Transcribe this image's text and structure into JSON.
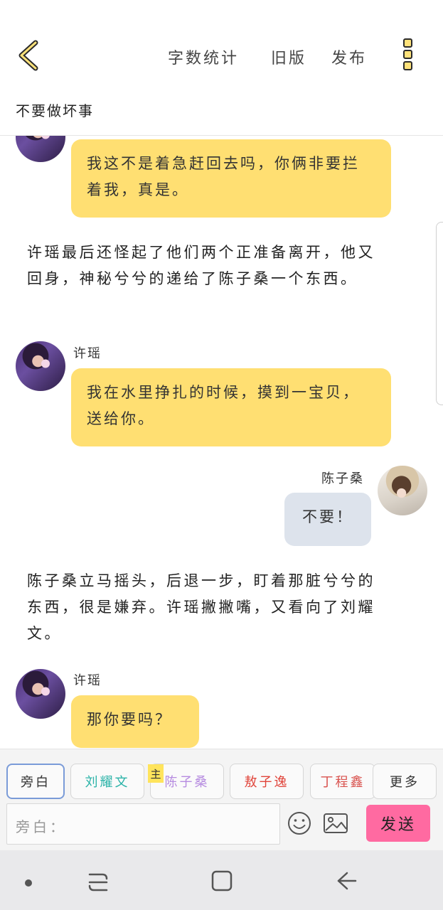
{
  "header": {
    "actions": {
      "word_count": "字数统计",
      "old_version": "旧版",
      "publish": "发布"
    }
  },
  "story": {
    "title": "不要做坏事"
  },
  "messages": {
    "m1": {
      "text": "我这不是着急赶回去吗，你俩非要拦着我，真是。"
    },
    "n1": {
      "text": "许瑶最后还怪起了他们两个正准备离开，他又回身，神秘兮兮的递给了陈子桑一个东西。"
    },
    "m2": {
      "speaker": "许瑶",
      "text": "我在水里挣扎的时候，摸到一宝贝，送给你。"
    },
    "m3": {
      "speaker": "陈子桑",
      "text": "不要！"
    },
    "n2": {
      "text": "陈子桑立马摇头，后退一步，盯着那脏兮兮的东西，很是嫌弃。许瑶撇撇嘴，又看向了刘耀文。"
    },
    "m4": {
      "speaker": "许瑶",
      "text": "那你要吗？"
    }
  },
  "composer": {
    "roles": [
      {
        "label": "旁白",
        "color": "#333333"
      },
      {
        "label": "刘耀文",
        "color": "#2bb3a8"
      },
      {
        "label": "陈子桑",
        "color": "#b68be0"
      },
      {
        "label": "敖子逸",
        "color": "#e0443a"
      },
      {
        "label": "丁程鑫",
        "color": "#d9534f"
      }
    ],
    "more_label": "更多",
    "main_badge": "主",
    "input_placeholder": "旁白：",
    "send_label": "发送"
  },
  "icons": {
    "back": "chevron-left-icon",
    "more": "vertical-dots-icon",
    "emoji": "smiley-icon",
    "image": "image-icon"
  },
  "colors": {
    "accent_yellow": "#ffdf72",
    "send_pink": "#ff6aa1",
    "grey_bubble": "#dde3ec"
  }
}
